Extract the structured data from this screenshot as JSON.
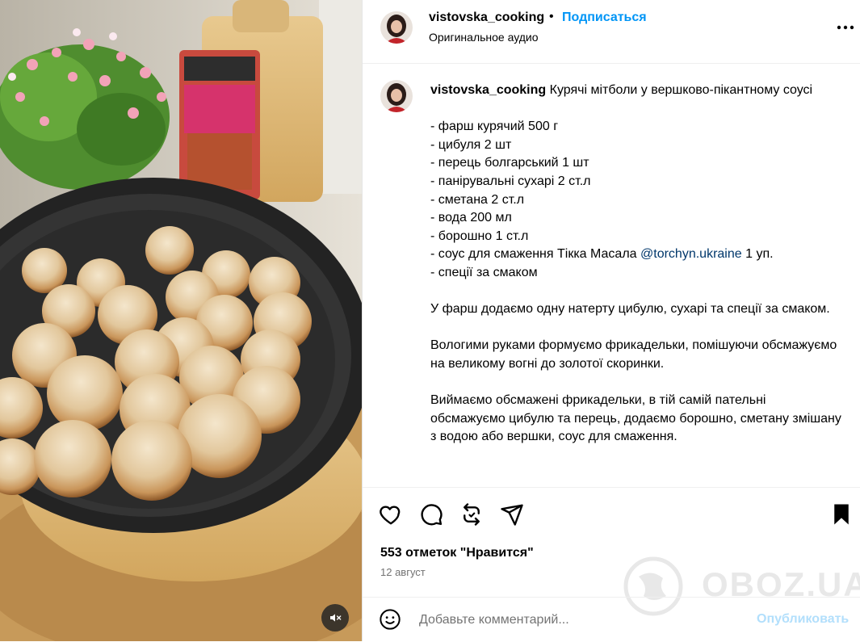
{
  "colors": {
    "accent": "#0095f6",
    "mention": "#00376b",
    "muted": "#737373",
    "post_disabled": "#b2dffc"
  },
  "media": {
    "mute_icon": "speaker-muted-icon"
  },
  "header": {
    "username": "vistovska_cooking",
    "dot": "•",
    "follow_label": "Подписаться",
    "audio_label": "Оригинальное аудио",
    "more_icon": "more-horizontal-icon"
  },
  "caption": {
    "username": "vistovska_cooking",
    "title": "Курячі мітболи у вершково-пікантному соусі",
    "ingredients_before": "- фарш курячий 500 г\n- цибуля 2 шт\n- перець болгарський 1 шт\n- панірувальні сухарі 2 ст.л\n- сметана 2 ст.л\n- вода 200 мл\n- борошно 1 ст.л\n- соус для смаження Тікка Масала ",
    "mention": "@torchyn.ukraine",
    "ingredients_after": " 1 уп.\n- спеції за смаком",
    "step1": "У фарш додаємо одну натерту цибулю, сухарі та спеції за смаком.",
    "step2": "Вологими руками формуємо фрикадельки, помішуючи обсмажуємо на великому вогні до золотої скоринки.",
    "step3": "Виймаємо обсмажені фрикадельки, в тій самій пательні обсмажуємо цибулю та перець, додаємо борошно, сметану змішану з водою або вершки, соус для смаження."
  },
  "actions": {
    "like_icon": "heart-icon",
    "comment_icon": "comment-icon",
    "repost_icon": "repost-icon",
    "share_icon": "share-icon",
    "save_icon": "bookmark-icon",
    "likes": "553 отметок \"Нравится\"",
    "date": "12 август"
  },
  "comment": {
    "emoji_icon": "emoji-icon",
    "placeholder": "Добавьте комментарий...",
    "post_label": "Опубликовать"
  },
  "watermark": {
    "text": "OBOZ.UA"
  }
}
